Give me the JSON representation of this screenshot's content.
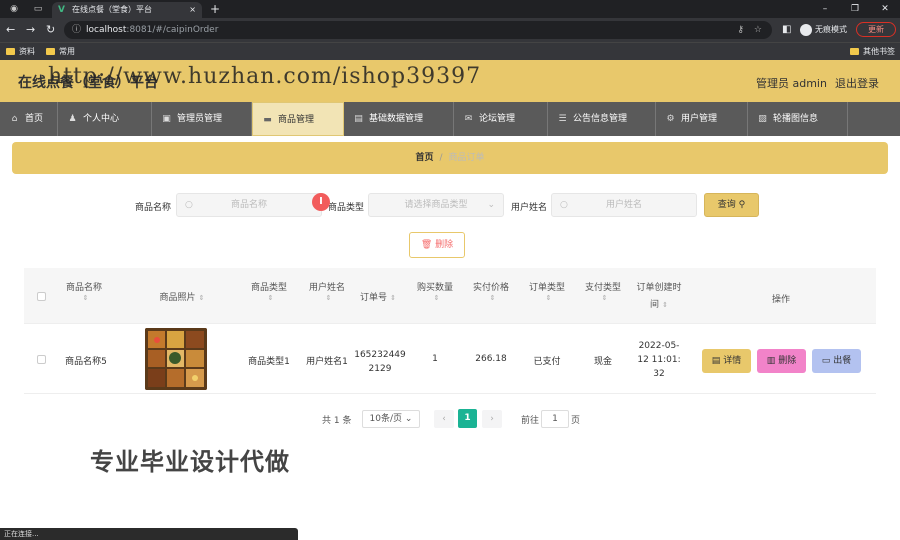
{
  "browser": {
    "tab_title": "在线点餐（堂食）平台",
    "tab_close": "×",
    "new_tab": "+",
    "url_host": "localhost",
    "url_path": ":8081/#/caipinOrder",
    "incognito_label": "无痕模式",
    "update_label": "更新",
    "bookmarks": [
      "资料",
      "常用",
      "其他书签"
    ],
    "window_controls": [
      "–",
      "❐",
      "✕"
    ]
  },
  "header": {
    "app_title": "在线点餐（堂食）平台",
    "watermark": "http://www.huzhan.com/ishop39397",
    "admin_text": "管理员 admin",
    "logout_label": "退出登录"
  },
  "menu": {
    "items": [
      {
        "label": "首页",
        "icon": "home-icon"
      },
      {
        "label": "个人中心",
        "icon": "user-icon"
      },
      {
        "label": "管理员管理",
        "icon": "admin-icon"
      },
      {
        "label": "商品管理",
        "icon": "monitor-icon"
      },
      {
        "label": "基础数据管理",
        "icon": "document-icon"
      },
      {
        "label": "论坛管理",
        "icon": "chat-icon"
      },
      {
        "label": "公告信息管理",
        "icon": "list-icon"
      },
      {
        "label": "用户管理",
        "icon": "gear-icon"
      },
      {
        "label": "轮播图信息",
        "icon": "image-icon"
      }
    ],
    "active_index": 3
  },
  "breadcrumb": {
    "home": "首页",
    "separator": "/",
    "current": "商品订单"
  },
  "search": {
    "name_label": "商品名称",
    "name_placeholder": "商品名称",
    "type_label": "商品类型",
    "type_placeholder": "请选择商品类型",
    "user_label": "用户姓名",
    "user_placeholder": "用户姓名",
    "search_button": "查询",
    "delete_button": "删除"
  },
  "table": {
    "headers": [
      "商品名称",
      "商品照片",
      "商品类型",
      "用户姓名",
      "订单号",
      "购买数量",
      "实付价格",
      "订单类型",
      "支付类型",
      "订单创建时间",
      "操作"
    ],
    "rows": [
      {
        "name": "商品名称5",
        "type": "商品类型1",
        "user": "用户姓名1",
        "order_no": "1652324492129",
        "quantity": "1",
        "price": "266.18",
        "order_type": "已支付",
        "pay_type": "现金",
        "created": "2022-05-12 11:01:32"
      }
    ],
    "actions": {
      "detail": "详情",
      "delete": "删除",
      "ship": "出餐"
    }
  },
  "pagination": {
    "total": "共 1 条",
    "page_size": "10条/页",
    "current_page": "1",
    "goto_label": "前往",
    "goto_value": "1",
    "page_unit": "页"
  },
  "promo_text": "专业毕业设计代做",
  "status_text": "正在连接...",
  "colors": {
    "header_bg": "#e8c86b",
    "menu_bg": "#5a5a5a",
    "primary_green": "#1ab394",
    "delete_pink": "#f283c9",
    "ship_blue": "#b3c2f0"
  }
}
